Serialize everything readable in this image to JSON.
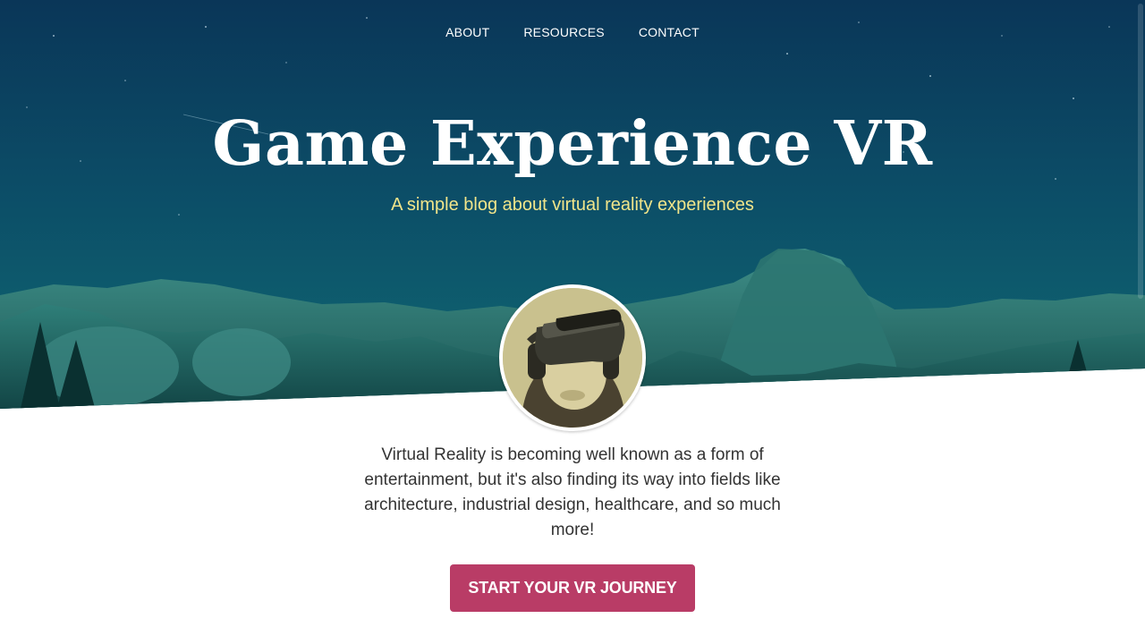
{
  "nav": {
    "items": [
      {
        "label": "ABOUT"
      },
      {
        "label": "RESOURCES"
      },
      {
        "label": "CONTACT"
      }
    ]
  },
  "hero": {
    "title": "Game Experience VR",
    "subtitle": "A simple blog about virtual reality experiences"
  },
  "intro": {
    "text": "Virtual Reality is becoming well known as a form of entertainment, but it's also finding its way into fields like architecture, industrial design, healthcare, and so much more!"
  },
  "cta": {
    "label": "START YOUR VR JOURNEY"
  },
  "colors": {
    "sky_top": "#0b3a5a",
    "sky_mid": "#0e5b6e",
    "mountains": "#1d6f6c",
    "subtitle": "#f1e58a",
    "button": "#b93c66",
    "text": "#333333"
  }
}
